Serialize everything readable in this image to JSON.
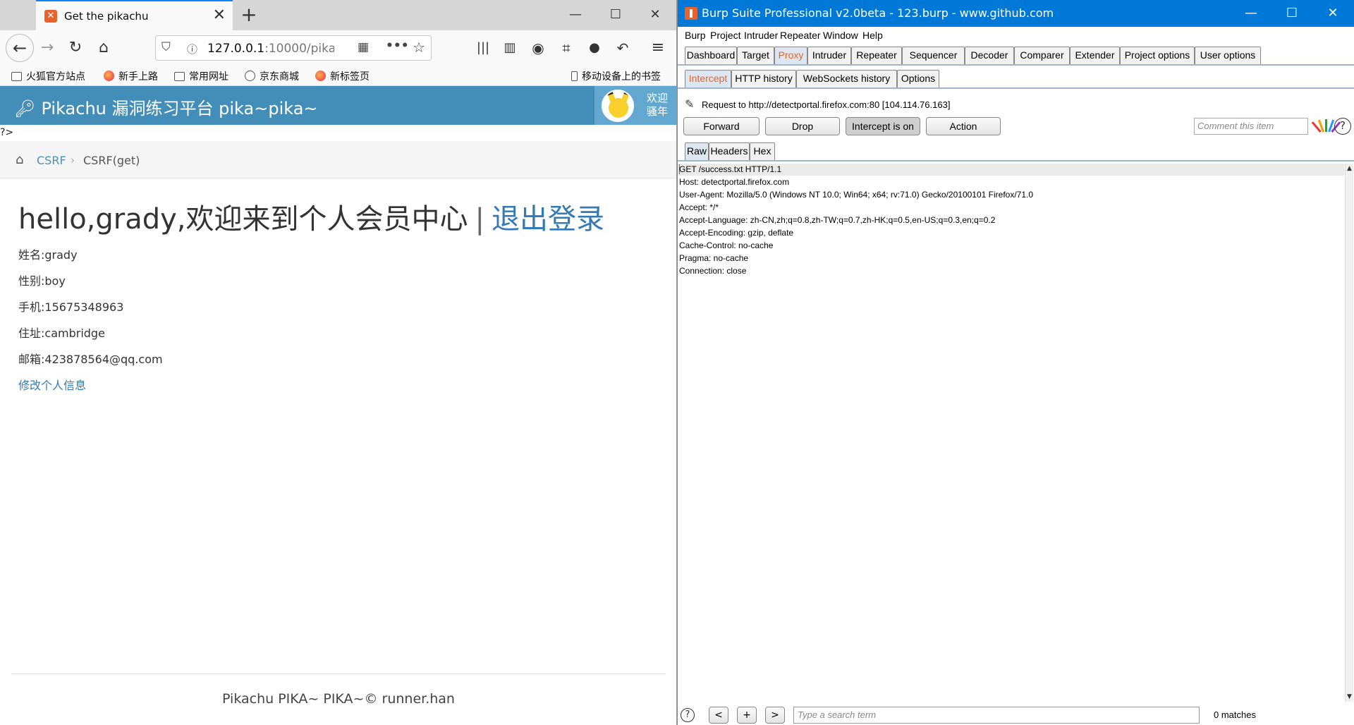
{
  "firefox": {
    "tab_title": "Get the pikachu",
    "url_host": "127.0.0.1",
    "url_rest": ":10000/pika",
    "bookmarks": [
      "火狐官方站点",
      "新手上路",
      "常用网址",
      "京东商城",
      "新标签页"
    ],
    "mobile_bookmarks": "移动设备上的书签"
  },
  "pikachu": {
    "site_title": "Pikachu 漏洞练习平台 pika~pika~",
    "welcome_line1": "欢迎",
    "welcome_line2": "骚年",
    "php_tag": "?>",
    "breadcrumb": {
      "section": "CSRF",
      "current": "CSRF(get)"
    },
    "hello": "hello,grady,欢迎来到个人会员中心",
    "separator": "|",
    "logout": "退出登录",
    "profile": {
      "name": "姓名:grady",
      "gender": "性别:boy",
      "phone": "手机:15675348963",
      "address": "住址:cambridge",
      "email": "邮箱:423878564@qq.com"
    },
    "edit_link": "修改个人信息",
    "footer": "Pikachu PIKA~ PIKA~© runner.han"
  },
  "burp": {
    "window_title": "Burp Suite Professional v2.0beta - 123.burp - www.github.com",
    "menu": [
      "Burp",
      "Project",
      "Intruder",
      "Repeater",
      "Window",
      "Help"
    ],
    "main_tabs": [
      "Dashboard",
      "Target",
      "Proxy",
      "Intruder",
      "Repeater",
      "Sequencer",
      "Decoder",
      "Comparer",
      "Extender",
      "Project options",
      "User options"
    ],
    "active_main_tab": "Proxy",
    "proxy_tabs": [
      "Intercept",
      "HTTP history",
      "WebSockets history",
      "Options"
    ],
    "active_proxy_tab": "Intercept",
    "request_info": "Request to http://detectportal.firefox.com:80  [104.114.76.163]",
    "buttons": {
      "forward": "Forward",
      "drop": "Drop",
      "intercept": "Intercept is on",
      "action": "Action"
    },
    "comment_placeholder": "Comment this item",
    "view_tabs": [
      "Raw",
      "Headers",
      "Hex"
    ],
    "active_view_tab": "Raw",
    "request_lines": [
      "GET /success.txt HTTP/1.1",
      "Host: detectportal.firefox.com",
      "User-Agent: Mozilla/5.0 (Windows NT 10.0; Win64; x64; rv:71.0) Gecko/20100101 Firefox/71.0",
      "Accept: */*",
      "Accept-Language: zh-CN,zh;q=0.8,zh-TW;q=0.7,zh-HK;q=0.5,en-US;q=0.3,en;q=0.2",
      "Accept-Encoding: gzip, deflate",
      "Cache-Control: no-cache",
      "Pragma: no-cache",
      "Connection: close"
    ],
    "search_placeholder": "Type a search term",
    "nav_buttons": [
      "<",
      "+",
      ">"
    ],
    "matches": "0 matches"
  }
}
